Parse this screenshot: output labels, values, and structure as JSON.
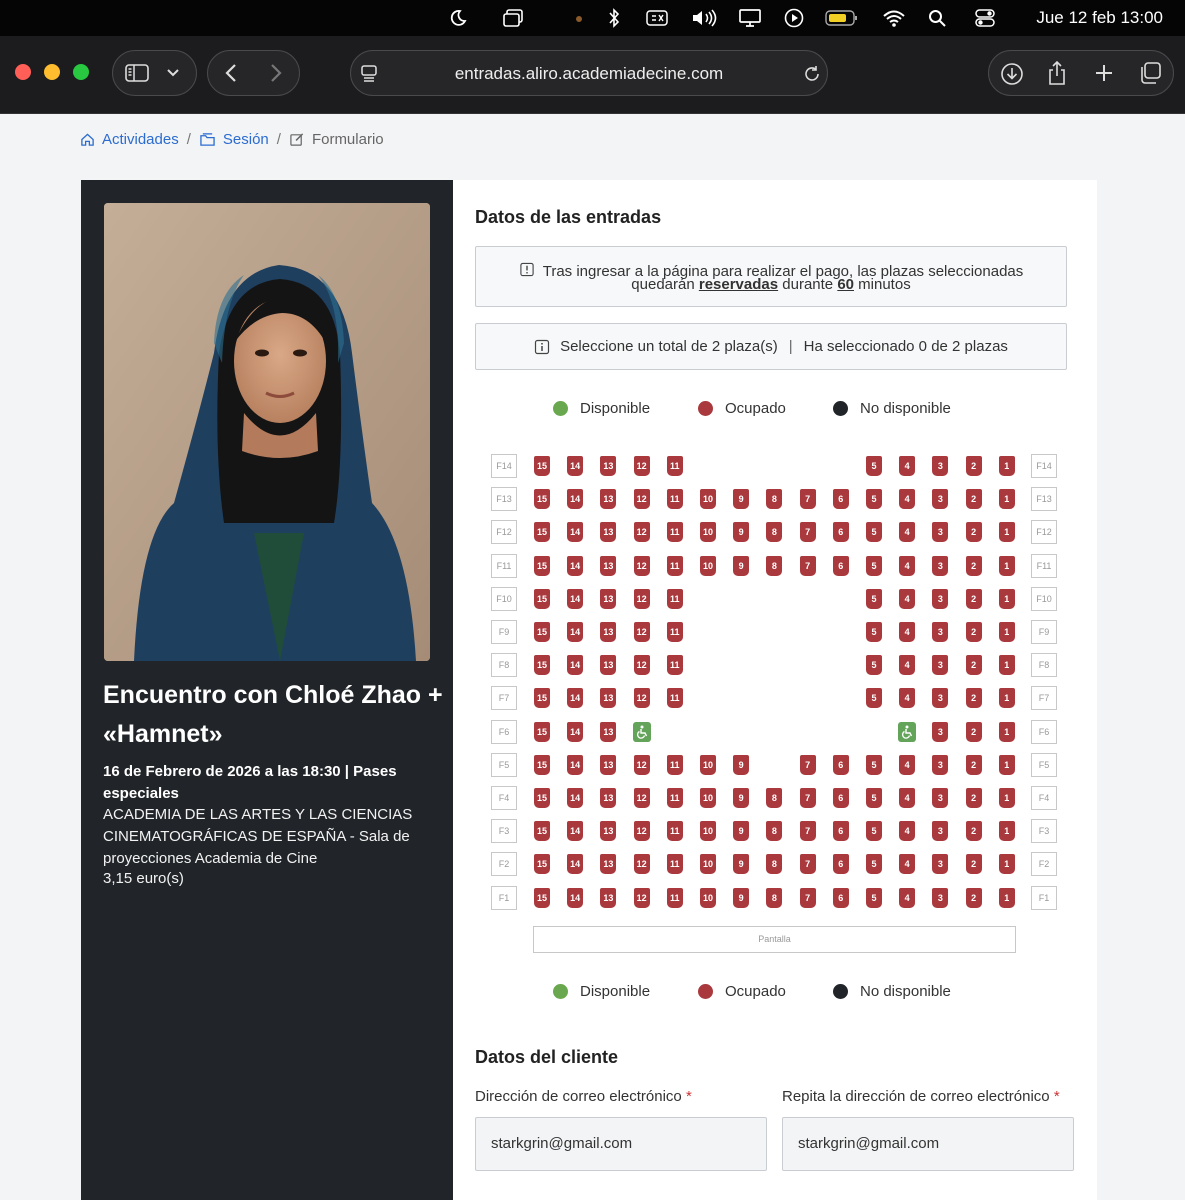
{
  "menubar": {
    "clock": "Jue 12 feb 13:00"
  },
  "browser": {
    "url": "entradas.aliro.academiadecine.com"
  },
  "breadcrumb": {
    "item1": "Actividades",
    "item2": "Sesión",
    "item3": "Formulario",
    "separator": "/"
  },
  "event": {
    "title": "Encuentro con Chloé Zhao + «Hamnet»",
    "date": "16 de Febrero de 2026 a las 18:30 | Pases especiales",
    "venue": "ACADEMIA DE LAS ARTES Y LAS CIENCIAS CINEMATOGRÁFICAS DE ESPAÑA - Sala de proyecciones Academia de Cine",
    "price": "3,15 euro(s)"
  },
  "tickets": {
    "heading": "Datos de las entradas",
    "notice_pre": "Tras ingresar a la página para realizar el pago, las plazas seleccionadas",
    "notice_mid1": "quedarán ",
    "notice_bold1": "reservadas",
    "notice_mid2": " durante ",
    "notice_bold2": "60",
    "notice_post": " minutos",
    "select_total": "Seleccione un total de 2 plaza(s)",
    "select_sep": "|",
    "selected_count": "Ha seleccionado 0 de 2 plazas"
  },
  "legend": {
    "available": "Disponible",
    "occupied": "Ocupado",
    "unavailable": "No disponible"
  },
  "colors": {
    "available": "#6aa84f",
    "occupied": "#a9393d",
    "unavailable": "#212529"
  },
  "seatmap": {
    "screen_label": "Pantalla",
    "wheelchair_icon": "wheelchair-icon",
    "rows": [
      {
        "label": "F14",
        "seats": [
          "15",
          "14",
          "13",
          "12",
          "11",
          "",
          "",
          "",
          "",
          "",
          "5",
          "4",
          "3",
          "2",
          "1"
        ]
      },
      {
        "label": "F13",
        "seats": [
          "15",
          "14",
          "13",
          "12",
          "11",
          "10",
          "9",
          "8",
          "7",
          "6",
          "5",
          "4",
          "3",
          "2",
          "1"
        ]
      },
      {
        "label": "F12",
        "seats": [
          "15",
          "14",
          "13",
          "12",
          "11",
          "10",
          "9",
          "8",
          "7",
          "6",
          "5",
          "4",
          "3",
          "2",
          "1"
        ]
      },
      {
        "label": "F11",
        "seats": [
          "15",
          "14",
          "13",
          "12",
          "11",
          "10",
          "9",
          "8",
          "7",
          "6",
          "5",
          "4",
          "3",
          "2",
          "1"
        ]
      },
      {
        "label": "F10",
        "seats": [
          "15",
          "14",
          "13",
          "12",
          "11",
          "",
          "",
          "",
          "",
          "",
          "5",
          "4",
          "3",
          "2",
          "1"
        ]
      },
      {
        "label": "F9",
        "seats": [
          "15",
          "14",
          "13",
          "12",
          "11",
          "",
          "",
          "",
          "",
          "",
          "5",
          "4",
          "3",
          "2",
          "1"
        ]
      },
      {
        "label": "F8",
        "seats": [
          "15",
          "14",
          "13",
          "12",
          "11",
          "",
          "",
          "",
          "",
          "",
          "5",
          "4",
          "3",
          "2",
          "1"
        ]
      },
      {
        "label": "F7",
        "seats": [
          "15",
          "14",
          "13",
          "12",
          "11",
          "",
          "",
          "",
          "",
          "",
          "5",
          "4",
          "3",
          "2",
          "1"
        ]
      },
      {
        "label": "F6",
        "seats": [
          "15",
          "14",
          "13",
          "W",
          "",
          "",
          "",
          "",
          "",
          "",
          "",
          "W",
          "3",
          "2",
          "1"
        ]
      },
      {
        "label": "F5",
        "seats": [
          "15",
          "14",
          "13",
          "12",
          "11",
          "10",
          "9",
          "",
          "7",
          "6",
          "5",
          "4",
          "3",
          "2",
          "1"
        ]
      },
      {
        "label": "F4",
        "seats": [
          "15",
          "14",
          "13",
          "12",
          "11",
          "10",
          "9",
          "8",
          "7",
          "6",
          "5",
          "4",
          "3",
          "2",
          "1"
        ]
      },
      {
        "label": "F3",
        "seats": [
          "15",
          "14",
          "13",
          "12",
          "11",
          "10",
          "9",
          "8",
          "7",
          "6",
          "5",
          "4",
          "3",
          "2",
          "1"
        ]
      },
      {
        "label": "F2",
        "seats": [
          "15",
          "14",
          "13",
          "12",
          "11",
          "10",
          "9",
          "8",
          "7",
          "6",
          "5",
          "4",
          "3",
          "2",
          "1"
        ]
      },
      {
        "label": "F1",
        "seats": [
          "15",
          "14",
          "13",
          "12",
          "11",
          "10",
          "9",
          "8",
          "7",
          "6",
          "5",
          "4",
          "3",
          "2",
          "1"
        ]
      }
    ]
  },
  "client": {
    "heading": "Datos del cliente",
    "email_label": "Dirección de correo electrónico",
    "email_repeat_label": "Repita la dirección de correo electrónico",
    "required_mark": "*",
    "email_value": "starkgrin@gmail.com",
    "email_repeat_value": "starkgrin@gmail.com"
  }
}
